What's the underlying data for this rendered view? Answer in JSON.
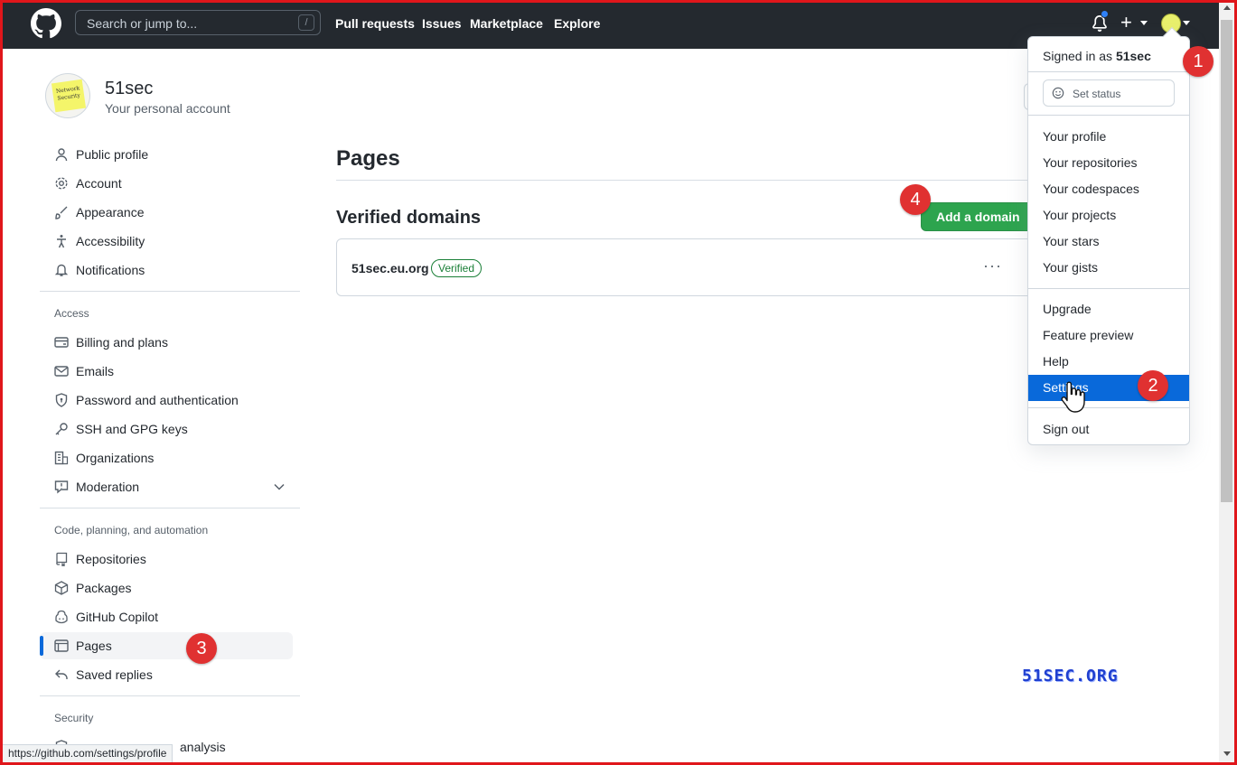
{
  "header": {
    "search_placeholder": "Search or jump to...",
    "search_shortcut": "/",
    "nav": [
      "Pull requests",
      "Issues",
      "Marketplace",
      "Explore"
    ],
    "plus_label": "+"
  },
  "profile": {
    "name": "51sec",
    "subtitle": "Your personal account",
    "avatar_text": "Network Security"
  },
  "sidebar": {
    "top_items": [
      {
        "label": "Public profile",
        "icon": "person-icon"
      },
      {
        "label": "Account",
        "icon": "gear-icon"
      },
      {
        "label": "Appearance",
        "icon": "paintbrush-icon"
      },
      {
        "label": "Accessibility",
        "icon": "accessibility-icon"
      },
      {
        "label": "Notifications",
        "icon": "bell-icon"
      }
    ],
    "access_heading": "Access",
    "access_items": [
      {
        "label": "Billing and plans",
        "icon": "credit-card-icon"
      },
      {
        "label": "Emails",
        "icon": "mail-icon"
      },
      {
        "label": "Password and authentication",
        "icon": "shield-lock-icon"
      },
      {
        "label": "SSH and GPG keys",
        "icon": "key-icon"
      },
      {
        "label": "Organizations",
        "icon": "organization-icon"
      },
      {
        "label": "Moderation",
        "icon": "report-icon"
      }
    ],
    "code_heading": "Code, planning, and automation",
    "code_items": [
      {
        "label": "Repositories",
        "icon": "repo-icon"
      },
      {
        "label": "Packages",
        "icon": "package-icon"
      },
      {
        "label": "GitHub Copilot",
        "icon": "copilot-icon"
      },
      {
        "label": "Pages",
        "icon": "browser-icon",
        "active": true
      },
      {
        "label": "Saved replies",
        "icon": "reply-icon"
      }
    ],
    "security_heading": "Security",
    "security_item_partial": "analysis"
  },
  "main": {
    "title": "Pages",
    "verified_domains_title": "Verified domains",
    "add_domain_label": "Add a domain",
    "domains": [
      {
        "name": "51sec.eu.org",
        "status": "Verified"
      }
    ],
    "kebab": "···"
  },
  "dropdown": {
    "signed_in_prefix": "Signed in as ",
    "username": "51sec",
    "set_status": "Set status",
    "group1": [
      "Your profile",
      "Your repositories",
      "Your codespaces",
      "Your projects",
      "Your stars",
      "Your gists"
    ],
    "group2": [
      "Upgrade",
      "Feature preview",
      "Help",
      "Settings"
    ],
    "highlighted": "Settings",
    "sign_out": "Sign out"
  },
  "annotations": [
    "1",
    "2",
    "3",
    "4"
  ],
  "watermark": "51SEC.ORG",
  "status_url": "https://github.com/settings/profile",
  "colors": {
    "header_bg": "#24292f",
    "primary_green": "#2da44e",
    "accent_blue": "#0969da",
    "annotation_red": "#e03131",
    "frame_red": "#e0161b"
  }
}
